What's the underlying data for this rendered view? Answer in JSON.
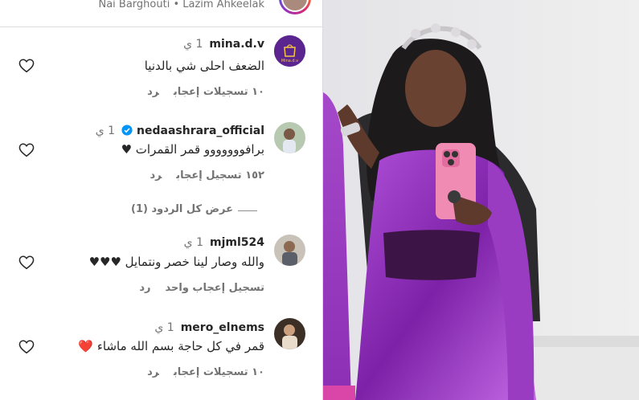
{
  "header": {
    "song": "Nai Barghouti • Lazim Ahkeelak"
  },
  "comments": [
    {
      "username": "mina.d.v",
      "time": "1 ي",
      "text": "الضعف احلى شي بالدنيا",
      "likes": "١٠ تسجيلات إعجاب",
      "reply": "رد",
      "avatar_label": "Mina.d.v",
      "verified": false
    },
    {
      "username": "nedaashrara_official",
      "time": "1 ي",
      "text": "برافووووووو قمر القمرات ♥",
      "likes": "١٥٢ تسجيل إعجاب",
      "reply": "رد",
      "verified": true
    },
    {
      "username": "mjml524",
      "time": "1 ي",
      "text": "والله وصار لينا خصر ونتمايل ♥♥♥",
      "likes": "تسجيل إعجاب واحد",
      "reply": "رد",
      "verified": false
    },
    {
      "username": "mero_elnems",
      "time": "1 ي",
      "text": "قمر في كل حاجة بسم الله ماشاء ❤️",
      "likes": "١٠ تسجيلات إعجاب",
      "reply": "رد",
      "verified": false
    }
  ],
  "view_replies": "عرض كل الردود (1)",
  "colors": {
    "text": "#262626",
    "secondary": "#737373",
    "verified": "#0095f6",
    "dress": "#8a2bb0",
    "phone_case": "#f08bb3"
  }
}
